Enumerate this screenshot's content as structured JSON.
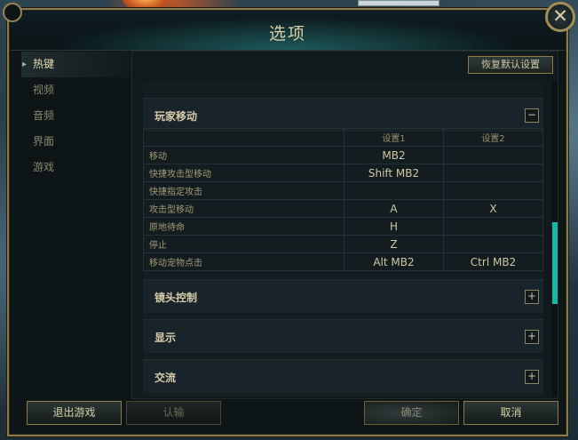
{
  "dialog": {
    "title": "选项",
    "close_label": "✕"
  },
  "sidebar": {
    "items": [
      {
        "label": "热键",
        "active": true
      },
      {
        "label": "视频",
        "active": false
      },
      {
        "label": "音频",
        "active": false
      },
      {
        "label": "界面",
        "active": false
      },
      {
        "label": "游戏",
        "active": false
      }
    ]
  },
  "toolbar": {
    "reset_label": "恢复默认设置"
  },
  "sections": [
    {
      "title": "玩家移动",
      "toggle": "−",
      "expanded": true
    },
    {
      "title": "镜头控制",
      "toggle": "+",
      "expanded": false
    },
    {
      "title": "显示",
      "toggle": "+",
      "expanded": false
    },
    {
      "title": "交流",
      "toggle": "+",
      "expanded": false
    }
  ],
  "bindings": {
    "columns": [
      "",
      "设置1",
      "设置2"
    ],
    "rows": [
      {
        "action": "移动",
        "key1": "MB2",
        "key2": ""
      },
      {
        "action": "快捷攻击型移动",
        "key1": "Shift  MB2",
        "key2": ""
      },
      {
        "action": "快捷指定攻击",
        "key1": "",
        "key2": ""
      },
      {
        "action": "攻击型移动",
        "key1": "A",
        "key2": "X"
      },
      {
        "action": "原地待命",
        "key1": "H",
        "key2": ""
      },
      {
        "action": "停止",
        "key1": "Z",
        "key2": ""
      },
      {
        "action": "移动宠物点击",
        "key1": "Alt  MB2",
        "key2": "Ctrl  MB2"
      }
    ]
  },
  "footer": {
    "exit_label": "退出游戏",
    "surrender_label": "认输",
    "confirm_label": "确定",
    "cancel_label": "取消"
  },
  "colors": {
    "accent": "#1fb2a6",
    "gold_border": "#8e7a48",
    "text_gold": "#d9cfa8"
  }
}
